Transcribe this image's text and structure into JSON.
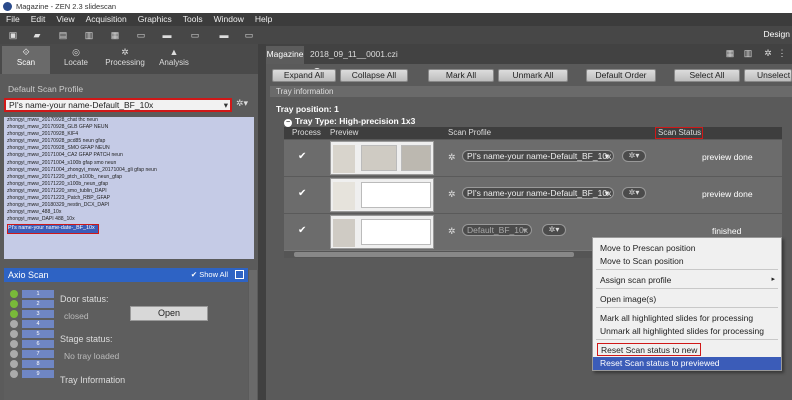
{
  "window": {
    "title": "Magazine - ZEN 2.3 slidescan"
  },
  "menu": [
    "File",
    "Edit",
    "View",
    "Acquisition",
    "Graphics",
    "Tools",
    "Window",
    "Help"
  ],
  "toolbar": {
    "design_label": "Design"
  },
  "left_tabs": [
    {
      "label": "Scan",
      "icon": "scan-icon"
    },
    {
      "label": "Locate",
      "icon": "locate-icon"
    },
    {
      "label": "Processing",
      "icon": "processing-icon"
    },
    {
      "label": "Analysis",
      "icon": "analysis-icon"
    }
  ],
  "default_scan_profile": {
    "label": "Default Scan Profile",
    "selected": "PI's name-your name-Default_BF_10x"
  },
  "profiles": [
    "zhongyi_mww_20170928_chat thc neun",
    "zhongyi_mww_20170928_GLB GFAP NEUN",
    "zhongyi_mww_20170928_KIF4",
    "zhongyi_mww_20170928_pcd85 neun gfap",
    "zhongyi_mww_20170928_SMO GFAP NEUN",
    "zhongyi_mww_20171004_CA2 GFAP PATCH neun",
    "zhongyi_mww_20171004_s100b gfap smo neun",
    "zhongyi_mww_20171004_zhongyi_mww_20171004_gli gfap neun",
    "zhongyi_mww_20171220_ptch_s100b_ neun_gfap",
    "zhongyi_mww_20171220_s100b_neun_gfap",
    "zhongyi_mww_20171220_smo_tublin_DAPI",
    "zhongyi_mww_20171223_Patch_RBP_GFAP",
    "zhongyi_mww_20180329_nestin_DCX_DAPI",
    "zhongyi_mww_488_10x",
    "zhongyi_mww_DAPI 488_10x"
  ],
  "profile_selected_item": "PI's name-your name-date-_BF_10x",
  "axio": {
    "title": "Axio Scan",
    "show_all": "Show All",
    "slots": [
      "1",
      "2",
      "3",
      "4",
      "5",
      "6",
      "7",
      "8",
      "9"
    ],
    "door_status_label": "Door status:",
    "door_status_value": "closed",
    "open_button": "Open",
    "stage_status_label": "Stage status:",
    "stage_status_value": "No tray loaded",
    "tray_info_label": "Tray Information"
  },
  "doc_tabs": {
    "magazine": "Magazine",
    "file": "2018_09_11__0001.czi"
  },
  "action_buttons": [
    "Expand All",
    "Collapse All",
    "Mark All",
    "Unmark All",
    "Default Order",
    "Select All",
    "Unselect"
  ],
  "tray_information": "Tray information",
  "tray_position": "Tray position:  1",
  "tray_type": "Tray Type:  High-precision 1x3",
  "table": {
    "headers": {
      "process": "Process",
      "preview": "Preview",
      "scan_profile": "Scan Profile",
      "scan_status": "Scan Status"
    },
    "rows": [
      {
        "check": "✔",
        "profile": "PI's name-your name-Default_BF_10x",
        "status": "preview done"
      },
      {
        "check": "✔",
        "profile": "PI's name-your name-Default_BF_10x",
        "status": "preview done"
      },
      {
        "check": "✔",
        "profile": "Default_BF_10x",
        "status": "finished"
      }
    ]
  },
  "context_menu": {
    "items": [
      "Move to Prescan position",
      "Move to Scan position",
      "Assign scan profile",
      "Open image(s)",
      "Mark all highlighted slides for processing",
      "Unmark all highlighted slides for processing",
      "Reset Scan status to new",
      "Reset Scan status to previewed"
    ]
  },
  "colors": {
    "highlight_red": "#d01818",
    "selection_blue": "#3b5cb8",
    "axio_header": "#2e63c4"
  }
}
